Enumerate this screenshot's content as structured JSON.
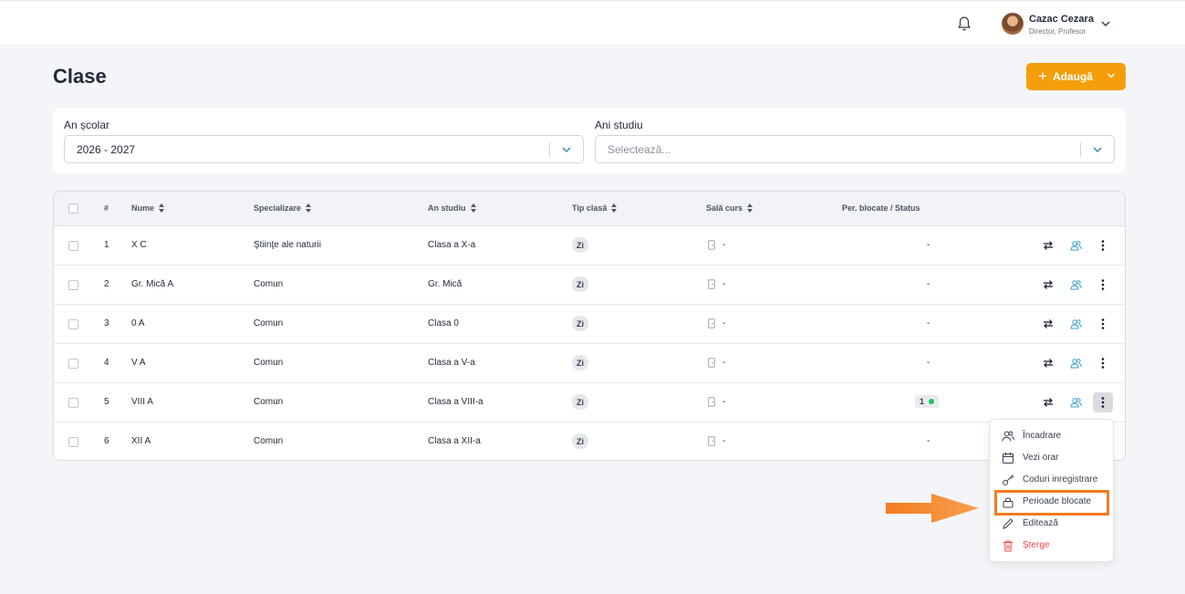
{
  "header": {
    "user_name": "Cazac Cezara",
    "user_role": "Director, Profesor"
  },
  "page": {
    "title": "Clase",
    "add_label": "Adaugă"
  },
  "filters": {
    "year_label": "An școlar",
    "year_value": "2026 - 2027",
    "study_label": "Ani studiu",
    "study_placeholder": "Selectează..."
  },
  "table": {
    "columns": [
      "#",
      "Nume",
      "Specializare",
      "An studiu",
      "Tip clasă",
      "Sală curs",
      "Per. blocate / Status"
    ],
    "rows": [
      {
        "num": "1",
        "name": "X C",
        "spec": "Ştiinţe ale naturii",
        "year": "Clasa a X-a",
        "type": "Zi",
        "room": "-",
        "status": "-"
      },
      {
        "num": "2",
        "name": "Gr. Mică A",
        "spec": "Comun",
        "year": "Gr. Mică",
        "type": "Zi",
        "room": "-",
        "status": "-"
      },
      {
        "num": "3",
        "name": "0 A",
        "spec": "Comun",
        "year": "Clasa 0",
        "type": "Zi",
        "room": "-",
        "status": "-"
      },
      {
        "num": "4",
        "name": "V A",
        "spec": "Comun",
        "year": "Clasa a V-a",
        "type": "Zi",
        "room": "-",
        "status": "-"
      },
      {
        "num": "5",
        "name": "VIII A",
        "spec": "Comun",
        "year": "Clasa a VIII-a",
        "type": "Zi",
        "room": "-",
        "status_count": "1"
      },
      {
        "num": "6",
        "name": "XII A",
        "spec": "Comun",
        "year": "Clasa a XII-a",
        "type": "Zi",
        "room": "-",
        "status": "-"
      }
    ]
  },
  "menu": {
    "items": [
      "Încadrare",
      "Vezi orar",
      "Coduri inregistrare",
      "Perioade blocate",
      "Editează",
      "Șterge"
    ]
  },
  "colors": {
    "accent": "#f59e0b",
    "highlight": "#f47c20",
    "danger": "#ef4444",
    "status_ok": "#22c55e"
  }
}
